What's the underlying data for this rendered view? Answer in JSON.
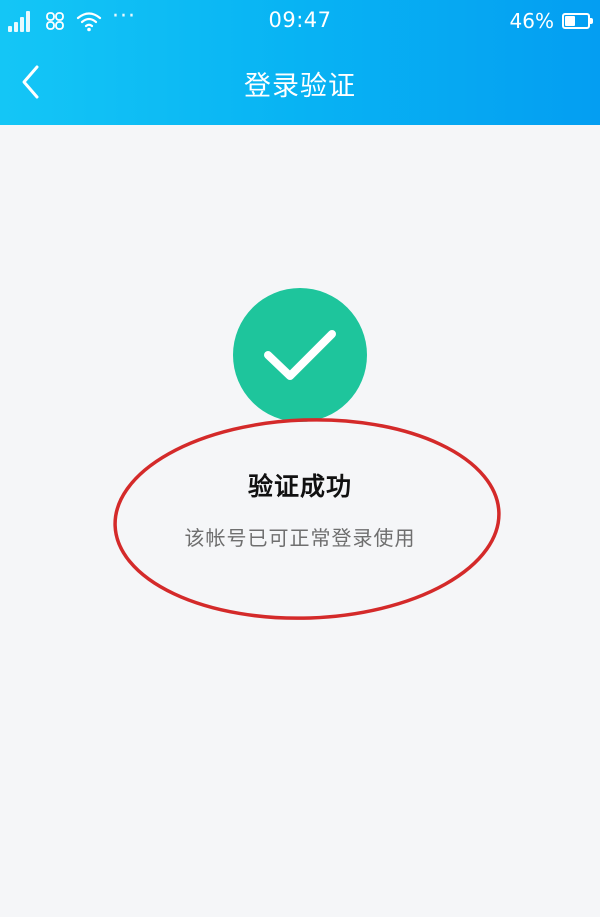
{
  "status_bar": {
    "time": "09:47",
    "battery_percent_text": "46%",
    "battery_level": 0.46,
    "more_indicator": "···",
    "icons": [
      "signal-icon",
      "carrier-logo-icon",
      "wifi-icon",
      "battery-icon"
    ]
  },
  "nav": {
    "title": "登录验证",
    "back_icon": "chevron-left-icon"
  },
  "result": {
    "icon": "checkmark-icon",
    "title": "验证成功",
    "description": "该帐号已可正常登录使用"
  },
  "colors": {
    "header_gradient_start": "#14c6f6",
    "header_gradient_end": "#049ef2",
    "success_green": "#1ec59c",
    "annotation_red": "#d42a2a",
    "background": "#f5f6f8"
  }
}
